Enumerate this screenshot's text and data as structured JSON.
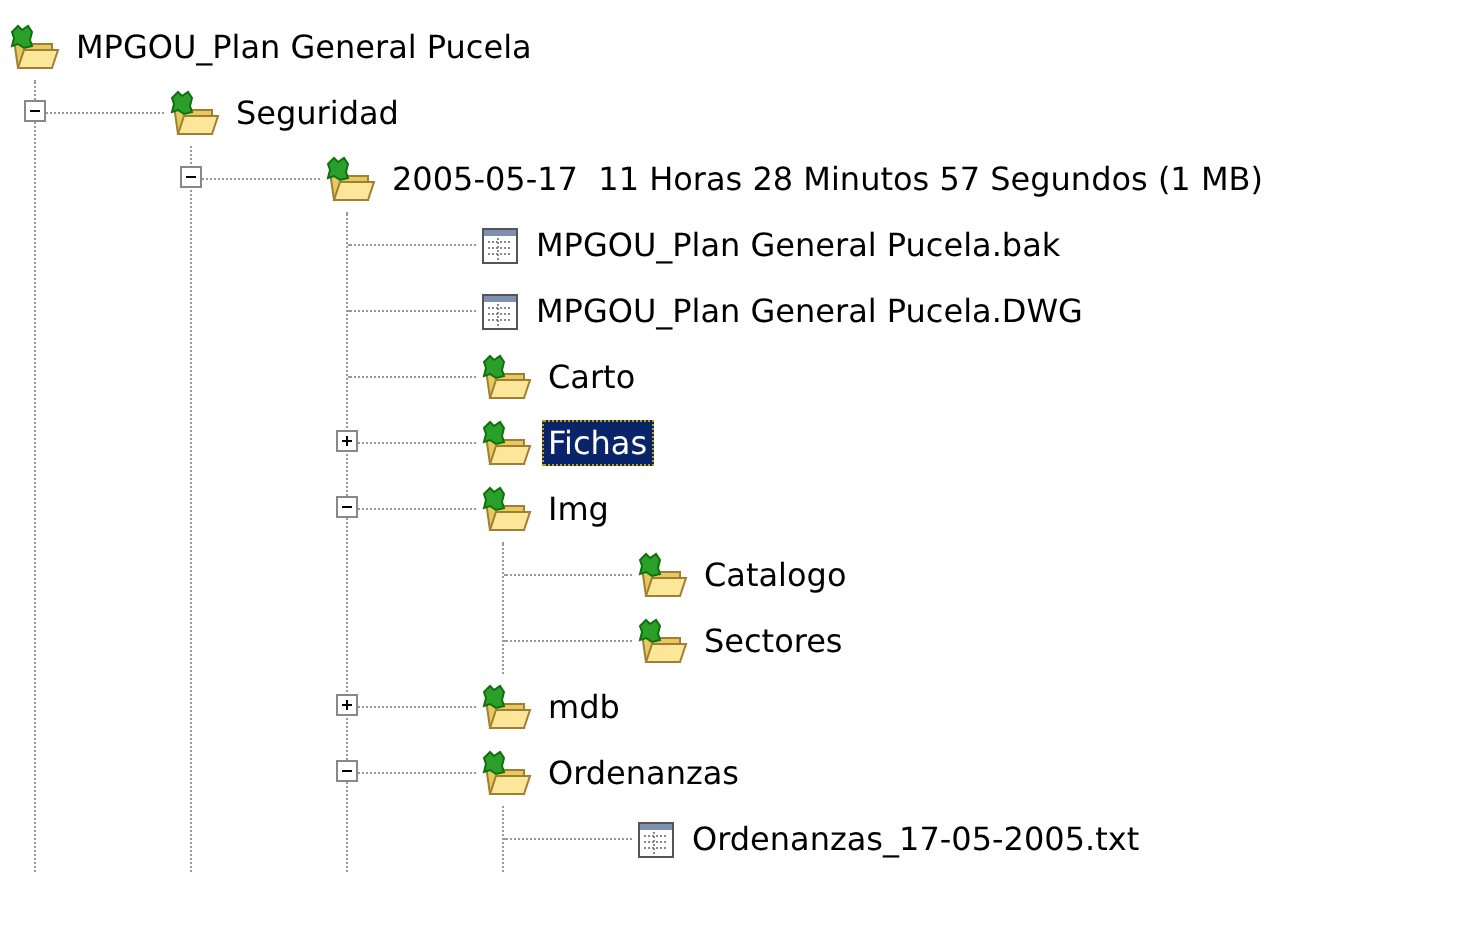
{
  "tree": [
    {
      "label": "MPGOU_Plan General Pucela",
      "kind": "folder",
      "selected": false,
      "children": [
        {
          "label": "Seguridad",
          "kind": "folder",
          "expanded": true,
          "selected": false,
          "children": [
            {
              "label": "2005-05-17  11 Horas 28 Minutos 57 Segundos (1 MB)",
              "kind": "folder",
              "expanded": true,
              "selected": false,
              "children": [
                {
                  "label": "MPGOU_Plan General Pucela.bak",
                  "kind": "file",
                  "selected": false
                },
                {
                  "label": "MPGOU_Plan General Pucela.DWG",
                  "kind": "file",
                  "selected": false
                },
                {
                  "label": "Carto",
                  "kind": "folder",
                  "selected": false
                },
                {
                  "label": "Fichas",
                  "kind": "folder",
                  "expanded": false,
                  "selected": true
                },
                {
                  "label": "Img",
                  "kind": "folder",
                  "expanded": true,
                  "selected": false,
                  "children": [
                    {
                      "label": "Catalogo",
                      "kind": "folder",
                      "selected": false
                    },
                    {
                      "label": "Sectores",
                      "kind": "folder",
                      "selected": false
                    }
                  ]
                },
                {
                  "label": "mdb",
                  "kind": "folder",
                  "expanded": false,
                  "selected": false
                },
                {
                  "label": "Ordenanzas",
                  "kind": "folder",
                  "expanded": true,
                  "selected": false,
                  "children": [
                    {
                      "label": "Ordenanzas_17-05-2005.txt",
                      "kind": "file",
                      "selected": false
                    }
                  ]
                }
              ]
            }
          ]
        }
      ]
    }
  ]
}
